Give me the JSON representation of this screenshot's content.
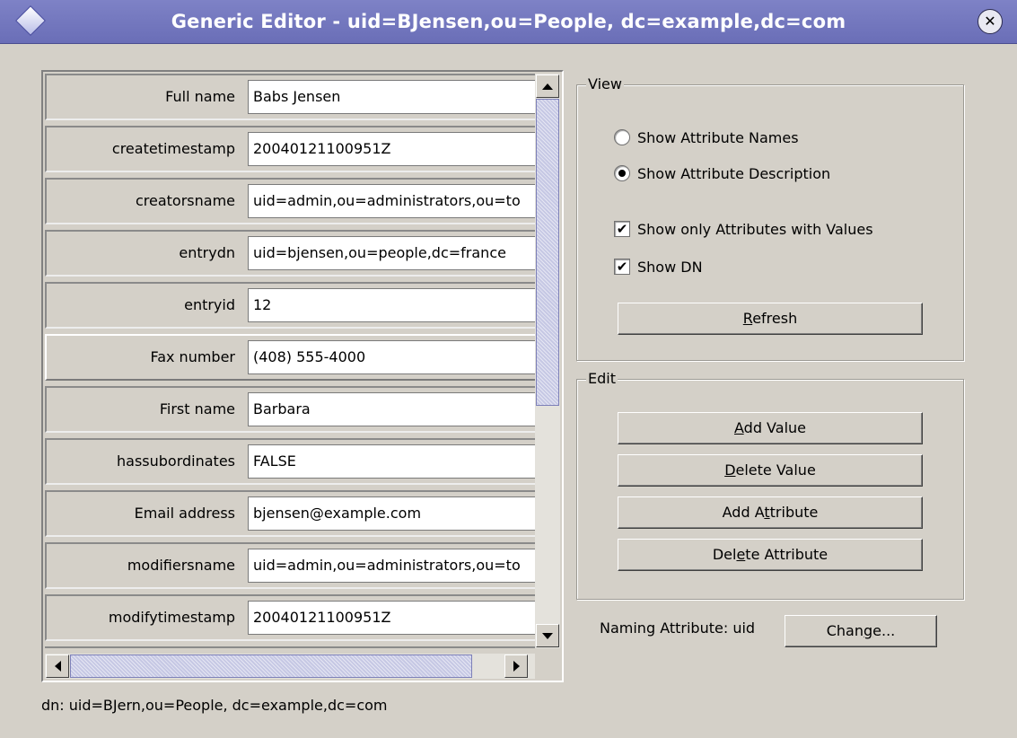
{
  "window": {
    "title": "Generic Editor - uid=BJensen,ou=People, dc=example,dc=com",
    "close_glyph": "✕"
  },
  "attributes": [
    {
      "label": "Full name",
      "value": "Babs Jensen"
    },
    {
      "label": "createtimestamp",
      "value": "20040121100951Z"
    },
    {
      "label": "creatorsname",
      "value": "uid=admin,ou=administrators,ou=to"
    },
    {
      "label": "entrydn",
      "value": "uid=bjensen,ou=people,dc=france"
    },
    {
      "label": "entryid",
      "value": "12"
    },
    {
      "label": "Fax number",
      "value": "(408) 555-4000"
    },
    {
      "label": "First name",
      "value": "Barbara"
    },
    {
      "label": "hassubordinates",
      "value": "FALSE"
    },
    {
      "label": "Email address",
      "value": "bjensen@example.com"
    },
    {
      "label": "modifiersname",
      "value": "uid=admin,ou=administrators,ou=to"
    },
    {
      "label": "modifytimestamp",
      "value": "20040121100951Z"
    },
    {
      "label": "",
      "value": ""
    }
  ],
  "dn_line": "dn: uid=BJern,ou=People, dc=example,dc=com",
  "view": {
    "title": "View",
    "radio_names": "Show Attribute Names",
    "radio_description": "Show Attribute Description",
    "check_only_values": "Show only Attributes with Values",
    "check_show_dn": "Show DN",
    "check_mark": "✔",
    "refresh_mnemonic": "R",
    "refresh_rest": "efresh"
  },
  "edit": {
    "title": "Edit",
    "add_value_mnemonic": "A",
    "add_value_rest": "dd Value",
    "delete_value_mnemonic": "D",
    "delete_value_rest": "elete Value",
    "add_attribute_pre": "Add A",
    "add_attribute_mnemonic": "t",
    "add_attribute_post": "tribute",
    "delete_attribute_pre": "Del",
    "delete_attribute_mnemonic": "e",
    "delete_attribute_post": "te Attribute"
  },
  "naming": {
    "label": "Naming Attribute: uid",
    "change_pre": "Chan",
    "change_mnemonic": "g",
    "change_post": "e..."
  }
}
